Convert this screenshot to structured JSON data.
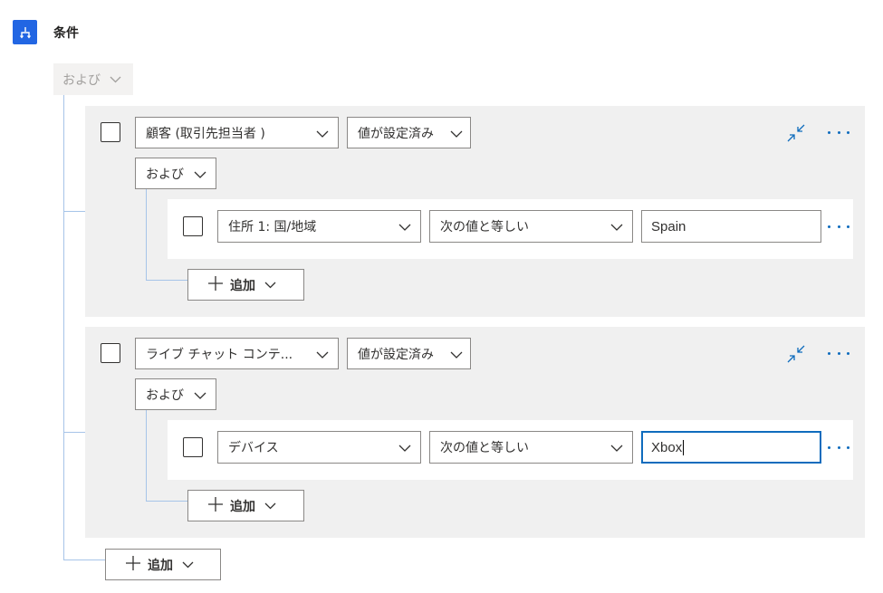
{
  "header": {
    "title": "条件",
    "icon": "branch-icon",
    "accent": "#2266e3"
  },
  "root": {
    "operator": "および"
  },
  "groups": [
    {
      "field": "顧客 (取引先担当者 )",
      "condition": "値が設定済み",
      "operator": "および",
      "row": {
        "field": "住所 1: 国/地域",
        "condition": "次の値と等しい",
        "value": "Spain"
      },
      "add_label": "追加"
    },
    {
      "field": "ライブ チャット コンテ...",
      "condition": "値が設定済み",
      "operator": "および",
      "row": {
        "field": "デバイス",
        "condition": "次の値と等しい",
        "value": "Xbox"
      },
      "add_label": "追加"
    }
  ],
  "root_add_label": "追加",
  "colors": {
    "link": "#0f6cbd",
    "group_bg": "#f0f0f0",
    "connector": "#a6c4e8"
  }
}
